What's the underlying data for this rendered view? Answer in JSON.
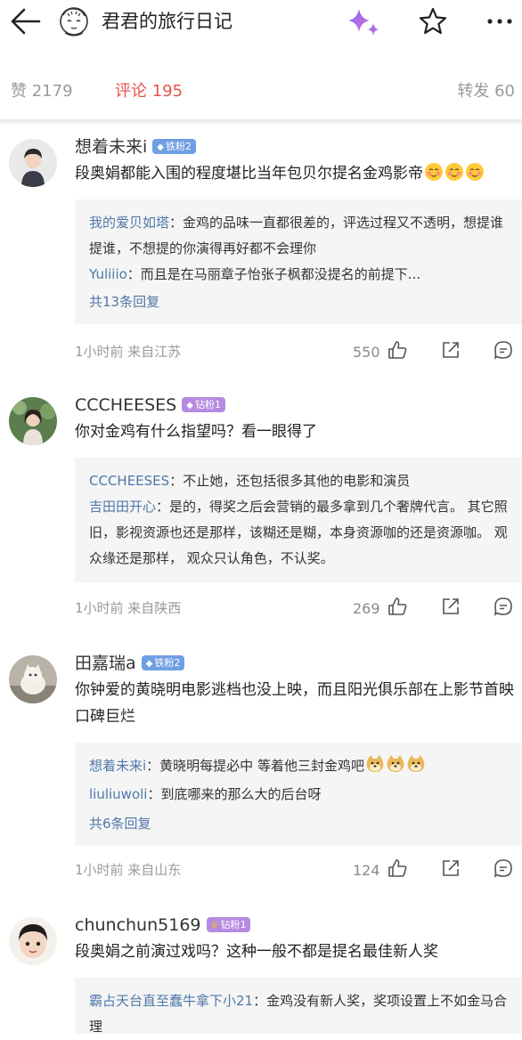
{
  "header": {
    "title": "君君的旅行日记",
    "icons": [
      "back-arrow-icon",
      "avatar-face-icon",
      "sparkle-icon",
      "star-icon",
      "more-icon"
    ]
  },
  "stats": {
    "likes": "赞 2179",
    "comments": "评论 195",
    "reposts": "转发 60"
  },
  "colors": {
    "accent_red": "#e8534a",
    "link_blue": "#4f78a8",
    "fan_blue": "#6e9fe3",
    "fan_purple": "#b58ae0",
    "crown_gold": "#f2b43a"
  },
  "comments": [
    {
      "user": "想着未来i",
      "badge": "铁粉2",
      "text": "段奥娟都能入围的程度堪比当年包贝尔提名金鸡影帝",
      "replies": [
        {
          "who": "我的爱贝如塔",
          "text": "：金鸡的品味一直都很差的，评选过程又不透明，想提谁提谁，不想提的你演得再好都不会理你"
        },
        {
          "who": "Yuliiio",
          "text": "：而且是在马丽章子怡张子枫都没提名的前提下..."
        }
      ],
      "more": "共13条回复",
      "meta": "1小时前  来自江苏",
      "likes": "550"
    },
    {
      "user": "CCCHEESES",
      "badge": "钻粉1",
      "text": "你对金鸡有什么指望吗？看一眼得了",
      "replies": [
        {
          "who": "CCCHEESES",
          "text": "：不止她，还包括很多其他的电影和演员"
        },
        {
          "who": "吉田田开心",
          "text": "：是的，得奖之后会营销的最多拿到几个奢牌代言。 其它照旧，影视资源也还是那样，该糊还是糊，本身资源咖的还是资源咖。 观众缘还是那样， 观众只认角色，不认奖。"
        }
      ],
      "meta": "1小时前  来自陕西",
      "likes": "269"
    },
    {
      "user": "田嘉瑞a",
      "badge": "铁粉2",
      "text": "你钟爱的黄晓明电影逃档也没上映，而且阳光俱乐部在上影节首映口碑巨烂",
      "replies": [
        {
          "who": "想着未来i",
          "text": "：黄晓明每提必中 等着他三封金鸡吧"
        },
        {
          "who": "liuliuwoli",
          "text": "：到底哪来的那么大的后台呀"
        }
      ],
      "more": "共6条回复",
      "meta": "1小时前  来自山东",
      "likes": "124"
    },
    {
      "user": "chunchun5169",
      "badge": "钻粉1",
      "text": "段奥娟之前演过戏吗？这种一般不都是提名最佳新人奖",
      "replies": [
        {
          "who": "霸占天台直至蠢牛拿下小21",
          "text": "：金鸡没有新人奖，奖项设置上不如金马合理"
        }
      ]
    }
  ]
}
